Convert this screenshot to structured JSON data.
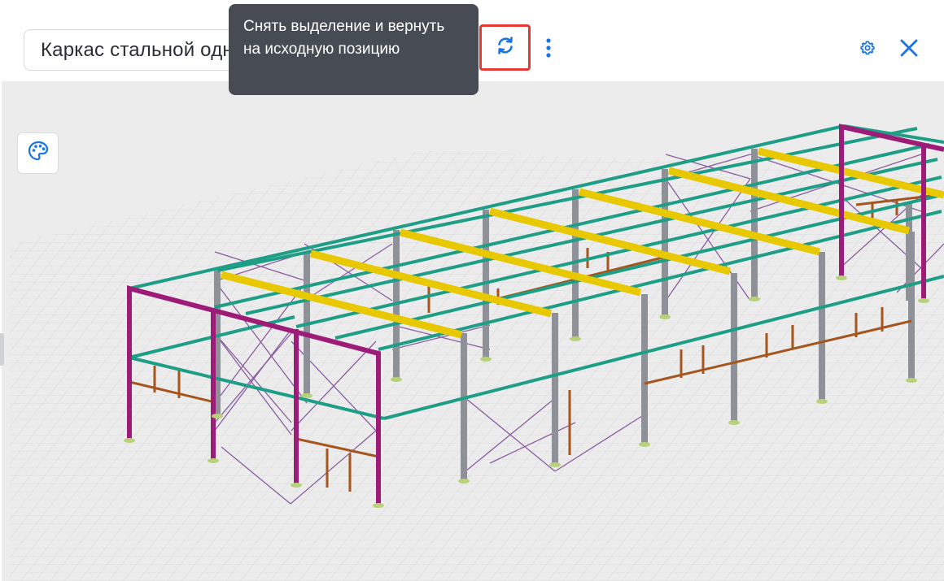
{
  "header": {
    "title_value": "Каркас стальной одноэтажного здания",
    "reset_tooltip": "Снять выделение и вернуть на исходную позицию"
  },
  "icons": {
    "reset": "refresh-icon",
    "more": "more-vertical-icon",
    "settings": "gear-icon",
    "close": "close-icon",
    "palette": "palette-icon"
  },
  "colors": {
    "accent": "#1a73e8",
    "highlight_border": "#e53935",
    "tooltip_bg": "#474c54",
    "frame_magenta": "#9c1c78",
    "beam_green": "#1e9e86",
    "purlin_yellow": "#e8c800",
    "column_gray": "#8e9298",
    "brace_purple": "#8a5ca0",
    "girt_brown": "#a4561e"
  }
}
